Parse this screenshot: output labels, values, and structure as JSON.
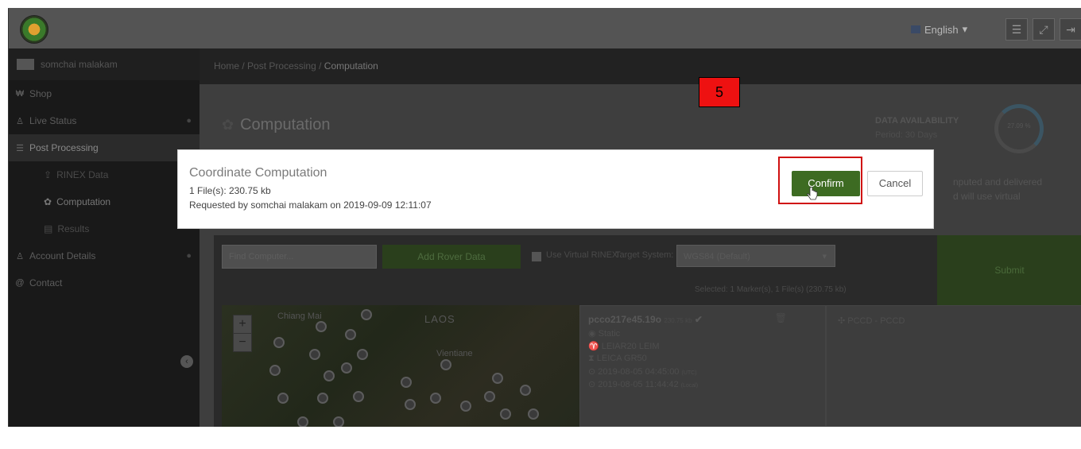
{
  "topbar": {
    "language": "English",
    "language_caret": "▾",
    "buttons": [
      "☰",
      "⤢",
      "⇥"
    ]
  },
  "sidebar": {
    "user": "somchai malakam",
    "items": [
      {
        "label": "Shop",
        "icon": "shop-icon"
      },
      {
        "label": "Live Status",
        "icon": "user-icon"
      },
      {
        "label": "Post Processing",
        "icon": "database-icon"
      },
      {
        "label": "RINEX Data",
        "icon": "upload-icon"
      },
      {
        "label": "Computation",
        "icon": "gear-icon"
      },
      {
        "label": "Results",
        "icon": "table-icon"
      },
      {
        "label": "Account Details",
        "icon": "user-icon"
      },
      {
        "label": "Contact",
        "icon": "at-icon"
      }
    ]
  },
  "breadcrumb": {
    "home": "Home",
    "sep1": "/",
    "section": "Post Processing",
    "sep2": "/",
    "current": "Computation"
  },
  "page": {
    "title": "Computation",
    "data_availability": {
      "label": "DATA AVAILABILITY",
      "period": "Period: 30 Days",
      "value": "27.09 %"
    },
    "side_text": {
      "line1": "nputed and delivered",
      "line2": "d will use virtual"
    }
  },
  "form": {
    "marker_placeholder": "Find Computer...",
    "add_rover": "Add Rover Data",
    "virtual_rinex": "Use Virtual RINEX",
    "target_system_label": "Target System:",
    "target_system_value": "WGS84 (Default)",
    "submit": "Submit",
    "selected": "Selected:  1 Marker(s), 1 File(s) (230.75 kb)"
  },
  "map": {
    "zoom_in": "+",
    "zoom_out": "−",
    "labels": {
      "chiang_mai": "Chiang Mai",
      "laos": "LAOS",
      "vientiane": "Vientiane"
    }
  },
  "file": {
    "name": "pcco217e45.19o",
    "size": "230.75 kb",
    "mode": "Static",
    "antenna": "LEIAR20 LEIM",
    "receiver": "LEICA GR50",
    "start": "2019-08-05 04:45:00",
    "start_tz": "(UTC)",
    "end": "2019-08-05 11:44:42",
    "end_tz": "(Local)"
  },
  "station": {
    "label": "PCCD - PCCD"
  },
  "modal": {
    "title": "Coordinate Computation",
    "files": "1 File(s): 230.75 kb",
    "requested": "Requested by somchai malakam on 2019-09-09 12:11:07",
    "confirm": "Confirm",
    "cancel": "Cancel"
  },
  "annotation": {
    "step": "5",
    "highlight_color": "#d01010",
    "step_color": "#ee1111"
  },
  "colors": {
    "confirm_green": "#3d6b22",
    "topbar": "#545454",
    "sidebar": "#191919"
  }
}
